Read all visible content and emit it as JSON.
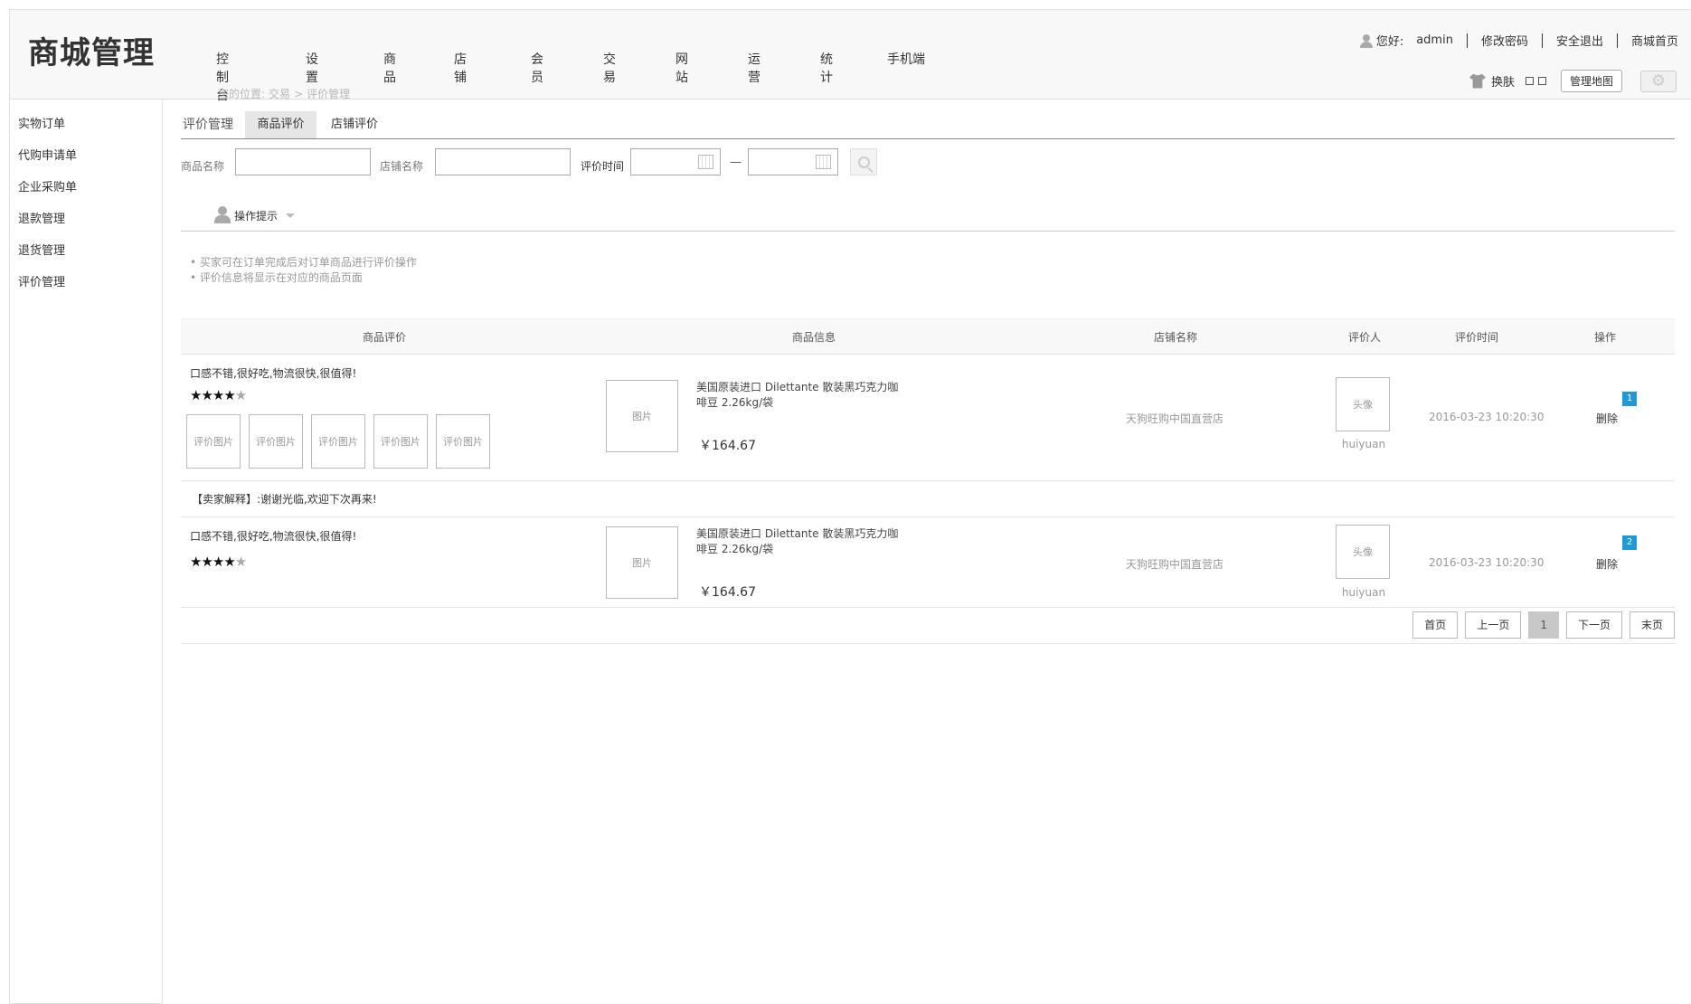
{
  "header": {
    "logo": "商城管理",
    "nav": [
      "控制台",
      "设置",
      "商品",
      "店铺",
      "会员",
      "交易",
      "网站",
      "运营",
      "统计",
      "手机端"
    ],
    "breadcrumb": {
      "prefix": "您的位置:",
      "level1": "交易",
      "sep": ">",
      "level2": "评价管理"
    },
    "user": {
      "greeting": "您好:",
      "name": "admin",
      "change_password": "修改密码",
      "logout": "安全退出",
      "home": "商城首页"
    },
    "skin_label": "换肤",
    "map_button": "管理地图"
  },
  "sidebar": {
    "items": [
      "实物订单",
      "代购申请单",
      "企业采购单",
      "退款管理",
      "退货管理",
      "评价管理"
    ]
  },
  "tabs": {
    "title": "评价管理",
    "product": "商品评价",
    "shop": "店铺评价"
  },
  "search": {
    "product_label": "商品名称",
    "shop_label": "店铺名称",
    "time_label": "评价时间",
    "dash": "—"
  },
  "tips": {
    "title": "操作提示",
    "items": [
      "买家可在订单完成后对订单商品进行评价操作",
      "评价信息将显示在对应的商品页面"
    ]
  },
  "table": {
    "headers": [
      "商品评价",
      "商品信息",
      "店铺名称",
      "评价人",
      "评价时间",
      "操作"
    ],
    "rows": [
      {
        "comment": "口感不错,很好吃,物流很快,很值得!",
        "stars_filled": "★★★★",
        "stars_empty": "★",
        "rating": 4,
        "review_images": [
          "评价图片",
          "评价图片",
          "评价图片",
          "评价图片",
          "评价图片"
        ],
        "product_image": "图片",
        "product_name": "美国原装进口 Dilettante 散装黑巧克力咖啡豆 2.26kg/袋",
        "price": "￥164.67",
        "shop": "天狗旺购中国直营店",
        "avatar": "头像",
        "reviewer": "huiyuan",
        "time": "2016-03-23 10:20:30",
        "badge": "1",
        "action": "删除",
        "reply": "【卖家解释】:谢谢光临,欢迎下次再来!"
      },
      {
        "comment": "口感不错,很好吃,物流很快,很值得!",
        "stars_filled": "★★★★",
        "stars_empty": "★",
        "rating": 4,
        "product_image": "图片",
        "product_name": "美国原装进口 Dilettante 散装黑巧克力咖啡豆 2.26kg/袋",
        "price": "￥164.67",
        "shop": "天狗旺购中国直营店",
        "avatar": "头像",
        "reviewer": "huiyuan",
        "time": "2016-03-23 10:20:30",
        "badge": "2",
        "action": "删除"
      }
    ]
  },
  "pager": {
    "first": "首页",
    "prev": "上一页",
    "current": "1",
    "next": "下一页",
    "last": "末页"
  },
  "colors": {
    "badge": "#1e9bd7",
    "header_bg": "#f8f8f8",
    "active_tab": "#e6e6e6"
  }
}
